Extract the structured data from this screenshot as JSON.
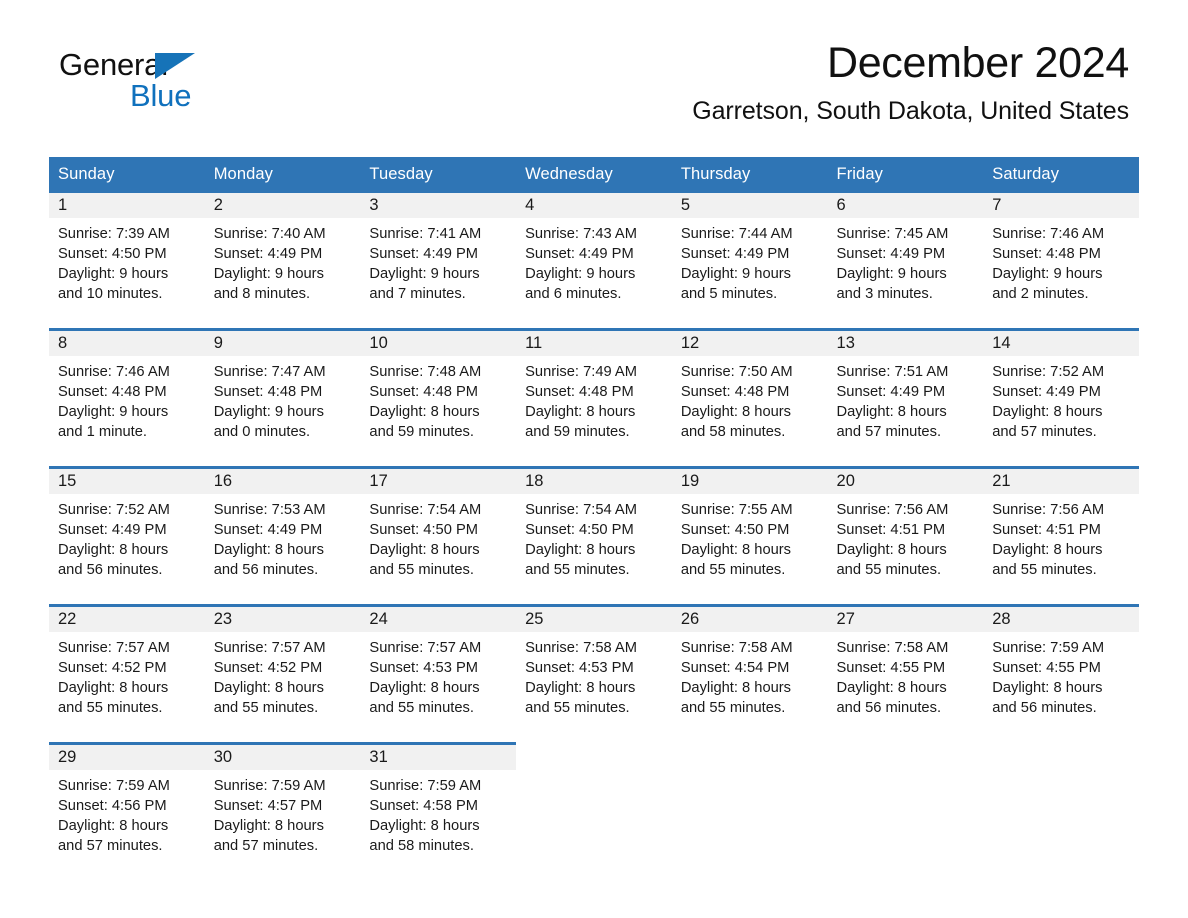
{
  "brand": {
    "line1": "General",
    "line2": "Blue",
    "triangle_color": "#1673b8",
    "blue_text_color": "#1071bd"
  },
  "header": {
    "title": "December 2024",
    "subtitle": "Garretson, South Dakota, United States",
    "accent_color": "#2f75b5",
    "daynum_band_color": "#f1f1f1"
  },
  "weekdays": [
    "Sunday",
    "Monday",
    "Tuesday",
    "Wednesday",
    "Thursday",
    "Friday",
    "Saturday"
  ],
  "weeks": [
    [
      {
        "day": "1",
        "lines": [
          "Sunrise: 7:39 AM",
          "Sunset: 4:50 PM",
          "Daylight: 9 hours",
          "and 10 minutes."
        ]
      },
      {
        "day": "2",
        "lines": [
          "Sunrise: 7:40 AM",
          "Sunset: 4:49 PM",
          "Daylight: 9 hours",
          "and 8 minutes."
        ]
      },
      {
        "day": "3",
        "lines": [
          "Sunrise: 7:41 AM",
          "Sunset: 4:49 PM",
          "Daylight: 9 hours",
          "and 7 minutes."
        ]
      },
      {
        "day": "4",
        "lines": [
          "Sunrise: 7:43 AM",
          "Sunset: 4:49 PM",
          "Daylight: 9 hours",
          "and 6 minutes."
        ]
      },
      {
        "day": "5",
        "lines": [
          "Sunrise: 7:44 AM",
          "Sunset: 4:49 PM",
          "Daylight: 9 hours",
          "and 5 minutes."
        ]
      },
      {
        "day": "6",
        "lines": [
          "Sunrise: 7:45 AM",
          "Sunset: 4:49 PM",
          "Daylight: 9 hours",
          "and 3 minutes."
        ]
      },
      {
        "day": "7",
        "lines": [
          "Sunrise: 7:46 AM",
          "Sunset: 4:48 PM",
          "Daylight: 9 hours",
          "and 2 minutes."
        ]
      }
    ],
    [
      {
        "day": "8",
        "lines": [
          "Sunrise: 7:46 AM",
          "Sunset: 4:48 PM",
          "Daylight: 9 hours",
          "and 1 minute."
        ]
      },
      {
        "day": "9",
        "lines": [
          "Sunrise: 7:47 AM",
          "Sunset: 4:48 PM",
          "Daylight: 9 hours",
          "and 0 minutes."
        ]
      },
      {
        "day": "10",
        "lines": [
          "Sunrise: 7:48 AM",
          "Sunset: 4:48 PM",
          "Daylight: 8 hours",
          "and 59 minutes."
        ]
      },
      {
        "day": "11",
        "lines": [
          "Sunrise: 7:49 AM",
          "Sunset: 4:48 PM",
          "Daylight: 8 hours",
          "and 59 minutes."
        ]
      },
      {
        "day": "12",
        "lines": [
          "Sunrise: 7:50 AM",
          "Sunset: 4:48 PM",
          "Daylight: 8 hours",
          "and 58 minutes."
        ]
      },
      {
        "day": "13",
        "lines": [
          "Sunrise: 7:51 AM",
          "Sunset: 4:49 PM",
          "Daylight: 8 hours",
          "and 57 minutes."
        ]
      },
      {
        "day": "14",
        "lines": [
          "Sunrise: 7:52 AM",
          "Sunset: 4:49 PM",
          "Daylight: 8 hours",
          "and 57 minutes."
        ]
      }
    ],
    [
      {
        "day": "15",
        "lines": [
          "Sunrise: 7:52 AM",
          "Sunset: 4:49 PM",
          "Daylight: 8 hours",
          "and 56 minutes."
        ]
      },
      {
        "day": "16",
        "lines": [
          "Sunrise: 7:53 AM",
          "Sunset: 4:49 PM",
          "Daylight: 8 hours",
          "and 56 minutes."
        ]
      },
      {
        "day": "17",
        "lines": [
          "Sunrise: 7:54 AM",
          "Sunset: 4:50 PM",
          "Daylight: 8 hours",
          "and 55 minutes."
        ]
      },
      {
        "day": "18",
        "lines": [
          "Sunrise: 7:54 AM",
          "Sunset: 4:50 PM",
          "Daylight: 8 hours",
          "and 55 minutes."
        ]
      },
      {
        "day": "19",
        "lines": [
          "Sunrise: 7:55 AM",
          "Sunset: 4:50 PM",
          "Daylight: 8 hours",
          "and 55 minutes."
        ]
      },
      {
        "day": "20",
        "lines": [
          "Sunrise: 7:56 AM",
          "Sunset: 4:51 PM",
          "Daylight: 8 hours",
          "and 55 minutes."
        ]
      },
      {
        "day": "21",
        "lines": [
          "Sunrise: 7:56 AM",
          "Sunset: 4:51 PM",
          "Daylight: 8 hours",
          "and 55 minutes."
        ]
      }
    ],
    [
      {
        "day": "22",
        "lines": [
          "Sunrise: 7:57 AM",
          "Sunset: 4:52 PM",
          "Daylight: 8 hours",
          "and 55 minutes."
        ]
      },
      {
        "day": "23",
        "lines": [
          "Sunrise: 7:57 AM",
          "Sunset: 4:52 PM",
          "Daylight: 8 hours",
          "and 55 minutes."
        ]
      },
      {
        "day": "24",
        "lines": [
          "Sunrise: 7:57 AM",
          "Sunset: 4:53 PM",
          "Daylight: 8 hours",
          "and 55 minutes."
        ]
      },
      {
        "day": "25",
        "lines": [
          "Sunrise: 7:58 AM",
          "Sunset: 4:53 PM",
          "Daylight: 8 hours",
          "and 55 minutes."
        ]
      },
      {
        "day": "26",
        "lines": [
          "Sunrise: 7:58 AM",
          "Sunset: 4:54 PM",
          "Daylight: 8 hours",
          "and 55 minutes."
        ]
      },
      {
        "day": "27",
        "lines": [
          "Sunrise: 7:58 AM",
          "Sunset: 4:55 PM",
          "Daylight: 8 hours",
          "and 56 minutes."
        ]
      },
      {
        "day": "28",
        "lines": [
          "Sunrise: 7:59 AM",
          "Sunset: 4:55 PM",
          "Daylight: 8 hours",
          "and 56 minutes."
        ]
      }
    ],
    [
      {
        "day": "29",
        "lines": [
          "Sunrise: 7:59 AM",
          "Sunset: 4:56 PM",
          "Daylight: 8 hours",
          "and 57 minutes."
        ]
      },
      {
        "day": "30",
        "lines": [
          "Sunrise: 7:59 AM",
          "Sunset: 4:57 PM",
          "Daylight: 8 hours",
          "and 57 minutes."
        ]
      },
      {
        "day": "31",
        "lines": [
          "Sunrise: 7:59 AM",
          "Sunset: 4:58 PM",
          "Daylight: 8 hours",
          "and 58 minutes."
        ]
      },
      {
        "day": "",
        "lines": []
      },
      {
        "day": "",
        "lines": []
      },
      {
        "day": "",
        "lines": []
      },
      {
        "day": "",
        "lines": []
      }
    ]
  ]
}
